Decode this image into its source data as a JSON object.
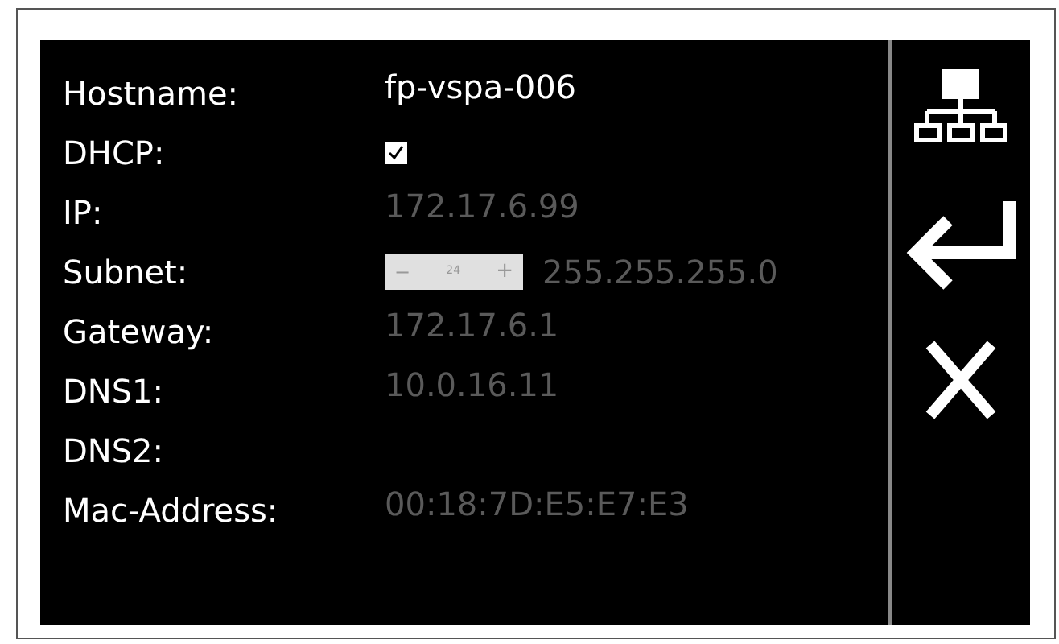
{
  "rows": [
    {
      "kind": "text",
      "label": "Hostname:",
      "value": "fp-vspa-006",
      "disabled": false
    },
    {
      "kind": "checkbox",
      "label": "DHCP:",
      "checked": true
    },
    {
      "kind": "text",
      "label": "IP:",
      "value": "172.17.6.99",
      "disabled": true
    },
    {
      "kind": "subnet",
      "label": "Subnet:",
      "minus": "−",
      "prefix": "24",
      "plus": "+",
      "value": "255.255.255.0",
      "disabled": true
    },
    {
      "kind": "text",
      "label": "Gateway:",
      "value": "172.17.6.1",
      "disabled": true
    },
    {
      "kind": "text",
      "label": "DNS1:",
      "value": "10.0.16.11",
      "disabled": true
    },
    {
      "kind": "text",
      "label": "DNS2:"
    },
    {
      "kind": "text",
      "label": "Mac-Address:",
      "value": "00:18:7D:E5:E7:E3",
      "disabled": true
    }
  ],
  "actions": [
    {
      "kind": "network"
    },
    {
      "kind": "enter"
    },
    {
      "kind": "close"
    }
  ]
}
